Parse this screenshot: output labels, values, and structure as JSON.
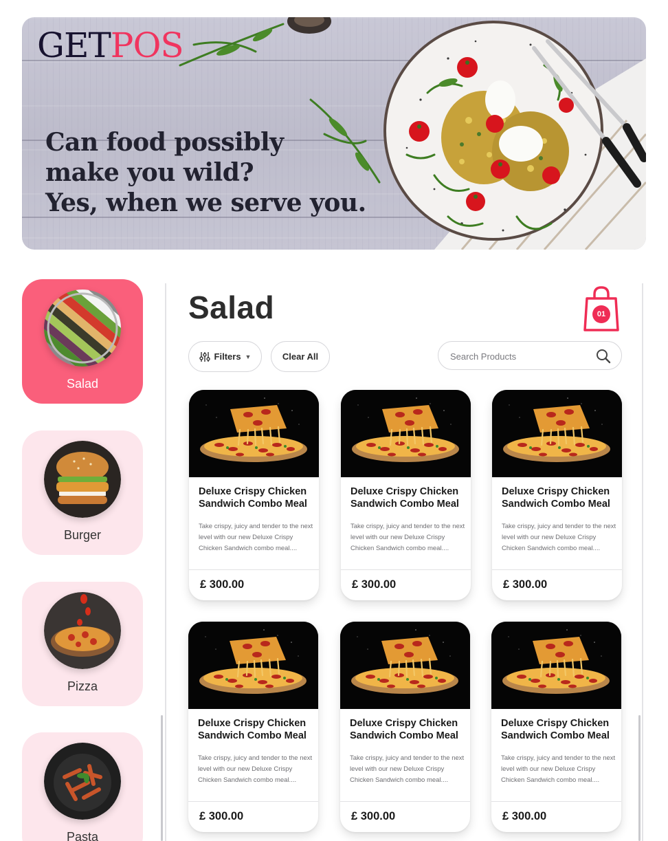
{
  "brand": {
    "part1": "GET",
    "part2": "POS"
  },
  "banner": {
    "tagline": [
      "Can food possibly",
      "make you wild?",
      "Yes, when we serve you."
    ]
  },
  "categories": [
    {
      "label": "Salad",
      "active": true
    },
    {
      "label": "Burger",
      "active": false
    },
    {
      "label": "Pizza",
      "active": false
    },
    {
      "label": "Pasta",
      "active": false
    }
  ],
  "section": {
    "title": "Salad"
  },
  "cart": {
    "count": "01"
  },
  "toolbar": {
    "filters_label": "Filters",
    "clear_label": "Clear All",
    "search_placeholder": "Search Products"
  },
  "products": [
    {
      "name": "Deluxe Crispy Chicken Sandwich Combo Meal",
      "description": "Take crispy, juicy and tender to the next level with our new Deluxe Crispy Chicken Sandwich combo meal....",
      "price": "£ 300.00"
    },
    {
      "name": "Deluxe Crispy Chicken Sandwich Combo Meal",
      "description": "Take crispy, juicy and tender to the next level with our new Deluxe Crispy Chicken Sandwich combo meal....",
      "price": "£ 300.00"
    },
    {
      "name": "Deluxe Crispy Chicken Sandwich Combo Meal",
      "description": "Take crispy, juicy and tender to the next level with our new Deluxe Crispy Chicken Sandwich combo meal....",
      "price": "£ 300.00"
    },
    {
      "name": "Deluxe Crispy Chicken Sandwich Combo Meal",
      "description": "Take crispy, juicy and tender to the next level with our new Deluxe Crispy Chicken Sandwich combo meal....",
      "price": "£ 300.00"
    },
    {
      "name": "Deluxe Crispy Chicken Sandwich Combo Meal",
      "description": "Take crispy, juicy and tender to the next level with our new Deluxe Crispy Chicken Sandwich combo meal....",
      "price": "£ 300.00"
    },
    {
      "name": "Deluxe Crispy Chicken Sandwich Combo Meal",
      "description": "Take crispy, juicy and tender to the next level with our new Deluxe Crispy Chicken Sandwich combo meal....",
      "price": "£ 300.00"
    }
  ],
  "colors": {
    "accent": "#fa5f7b",
    "brand_pink": "#f0355f",
    "brand_navy": "#17122f",
    "category_bg": "#fde6ec"
  }
}
